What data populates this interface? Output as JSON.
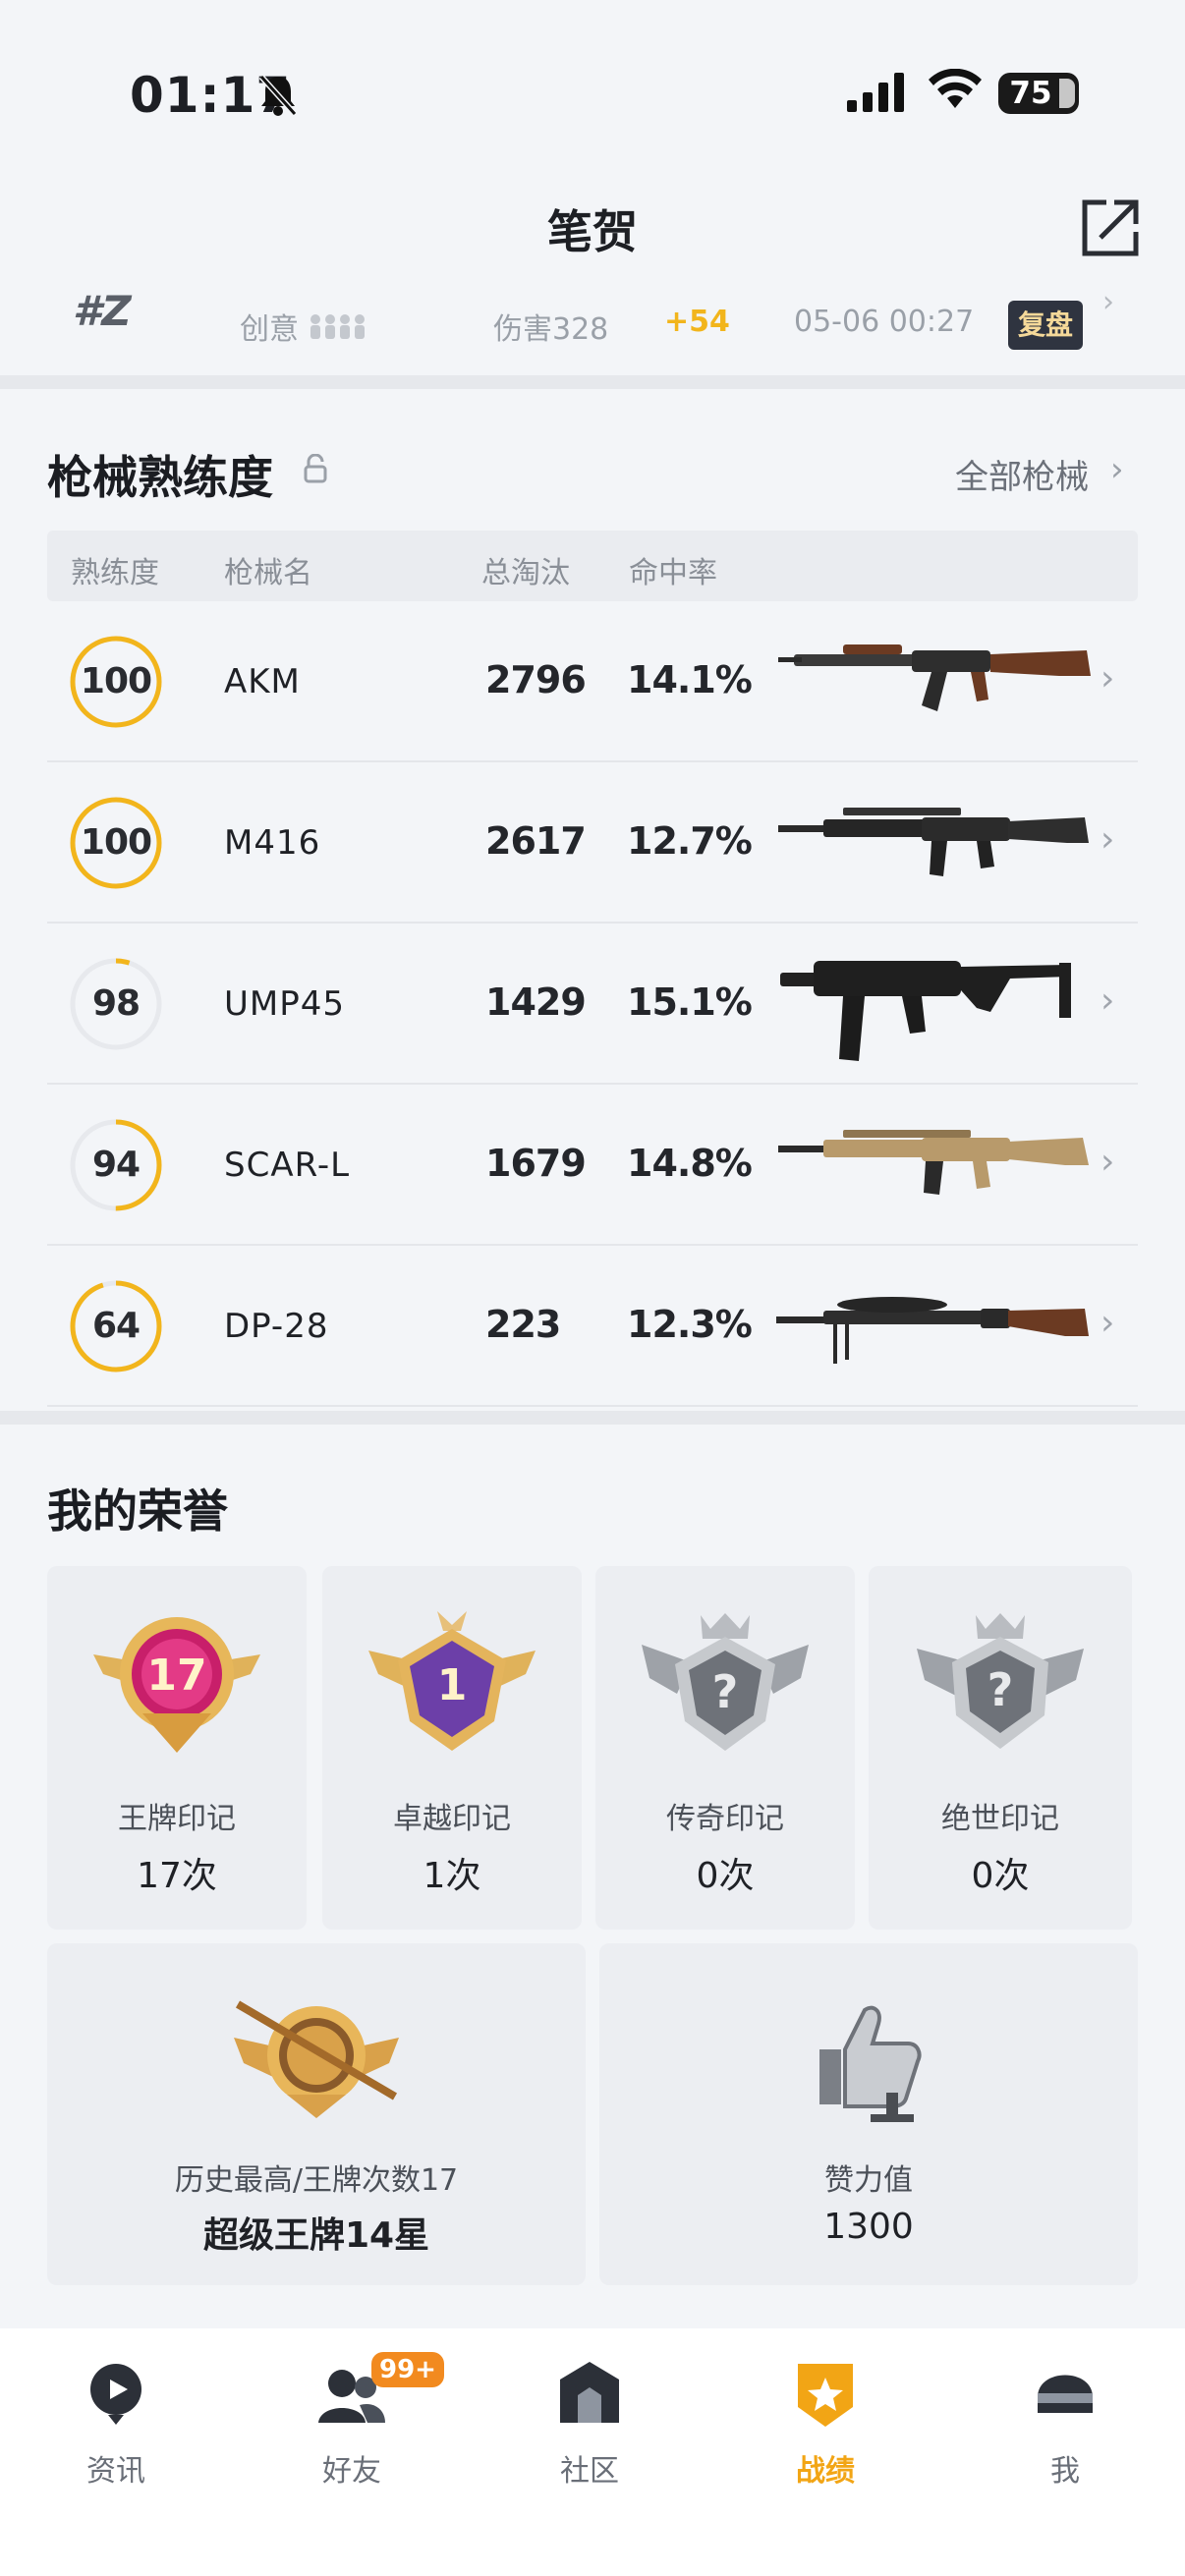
{
  "status_bar": {
    "time": "01:17",
    "battery": "75"
  },
  "header": {
    "title": "笔贺"
  },
  "match": {
    "rank": "#Z",
    "mode": "创意",
    "damage": "伤害328",
    "points": "+54",
    "date": "05-06 00:27",
    "review": "复盘"
  },
  "weapons_section": {
    "title": "枪械熟练度",
    "all_link": "全部枪械",
    "columns": [
      "熟练度",
      "枪械名",
      "总淘汰",
      "命中率"
    ],
    "rows": [
      {
        "level": "100",
        "progress": 1.0,
        "name": "AKM",
        "kills": "2796",
        "rate": "14.1%"
      },
      {
        "level": "100",
        "progress": 1.0,
        "name": "M416",
        "kills": "2617",
        "rate": "12.7%"
      },
      {
        "level": "98",
        "progress": 0.05,
        "name": "UMP45",
        "kills": "1429",
        "rate": "15.1%"
      },
      {
        "level": "94",
        "progress": 0.5,
        "name": "SCAR-L",
        "kills": "1679",
        "rate": "14.8%"
      },
      {
        "level": "64",
        "progress": 0.95,
        "name": "DP-28",
        "kills": "223",
        "rate": "12.3%"
      }
    ]
  },
  "honors_section": {
    "title": "我的荣誉",
    "cards": [
      {
        "label": "王牌印记",
        "value": "17次",
        "badge_text": "17"
      },
      {
        "label": "卓越印记",
        "value": "1次",
        "badge_text": "1"
      },
      {
        "label": "传奇印记",
        "value": "0次",
        "badge_text": "?"
      },
      {
        "label": "绝世印记",
        "value": "0次",
        "badge_text": "?"
      }
    ],
    "history": {
      "label": "历史最高/王牌次数17",
      "value": "超级王牌14星"
    },
    "likes": {
      "label": "赞力值",
      "value": "1300"
    }
  },
  "nav": {
    "items": [
      {
        "label": "资讯"
      },
      {
        "label": "好友",
        "badge": "99+"
      },
      {
        "label": "社区"
      },
      {
        "label": "战绩"
      },
      {
        "label": "我"
      }
    ]
  },
  "colors": {
    "accent": "#f2b51c",
    "ring_track": "#e7e9ed",
    "nav_active": "#f2a515"
  }
}
